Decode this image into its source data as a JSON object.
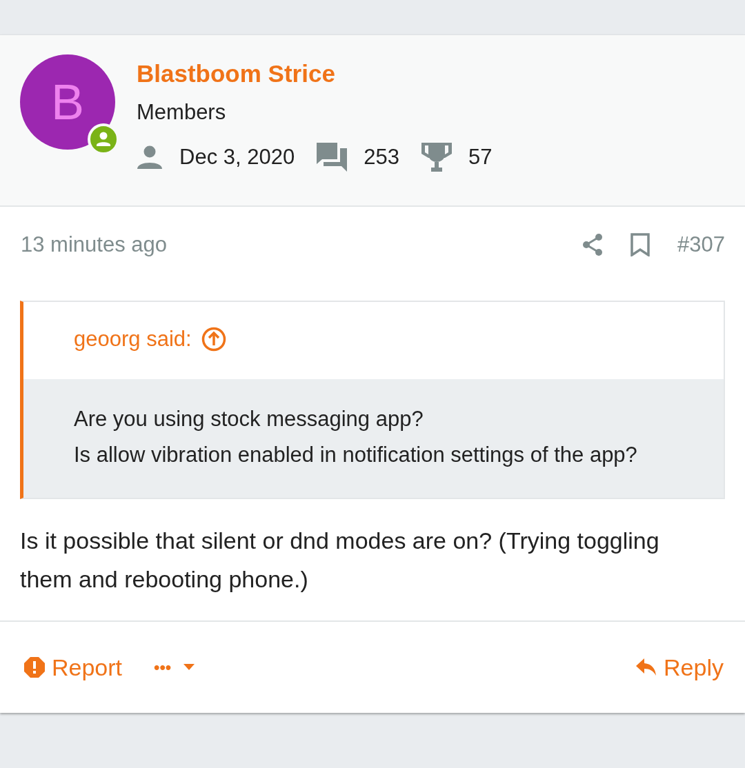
{
  "author": {
    "avatar_letter": "B",
    "name": "Blastboom Strice",
    "role": "Members",
    "joined": "Dec 3, 2020",
    "messages": "253",
    "points": "57"
  },
  "post": {
    "time": "13 minutes ago",
    "number": "#307",
    "quote": {
      "attribution": "geoorg said:",
      "lines": [
        "Are you using stock messaging app?",
        "Is allow vibration enabled in notification settings of the app?"
      ]
    },
    "body": "Is it possible that silent or dnd modes are on? (Trying toggling them and rebooting phone.)"
  },
  "actions": {
    "report": "Report",
    "more": "•••",
    "reply": "Reply"
  }
}
